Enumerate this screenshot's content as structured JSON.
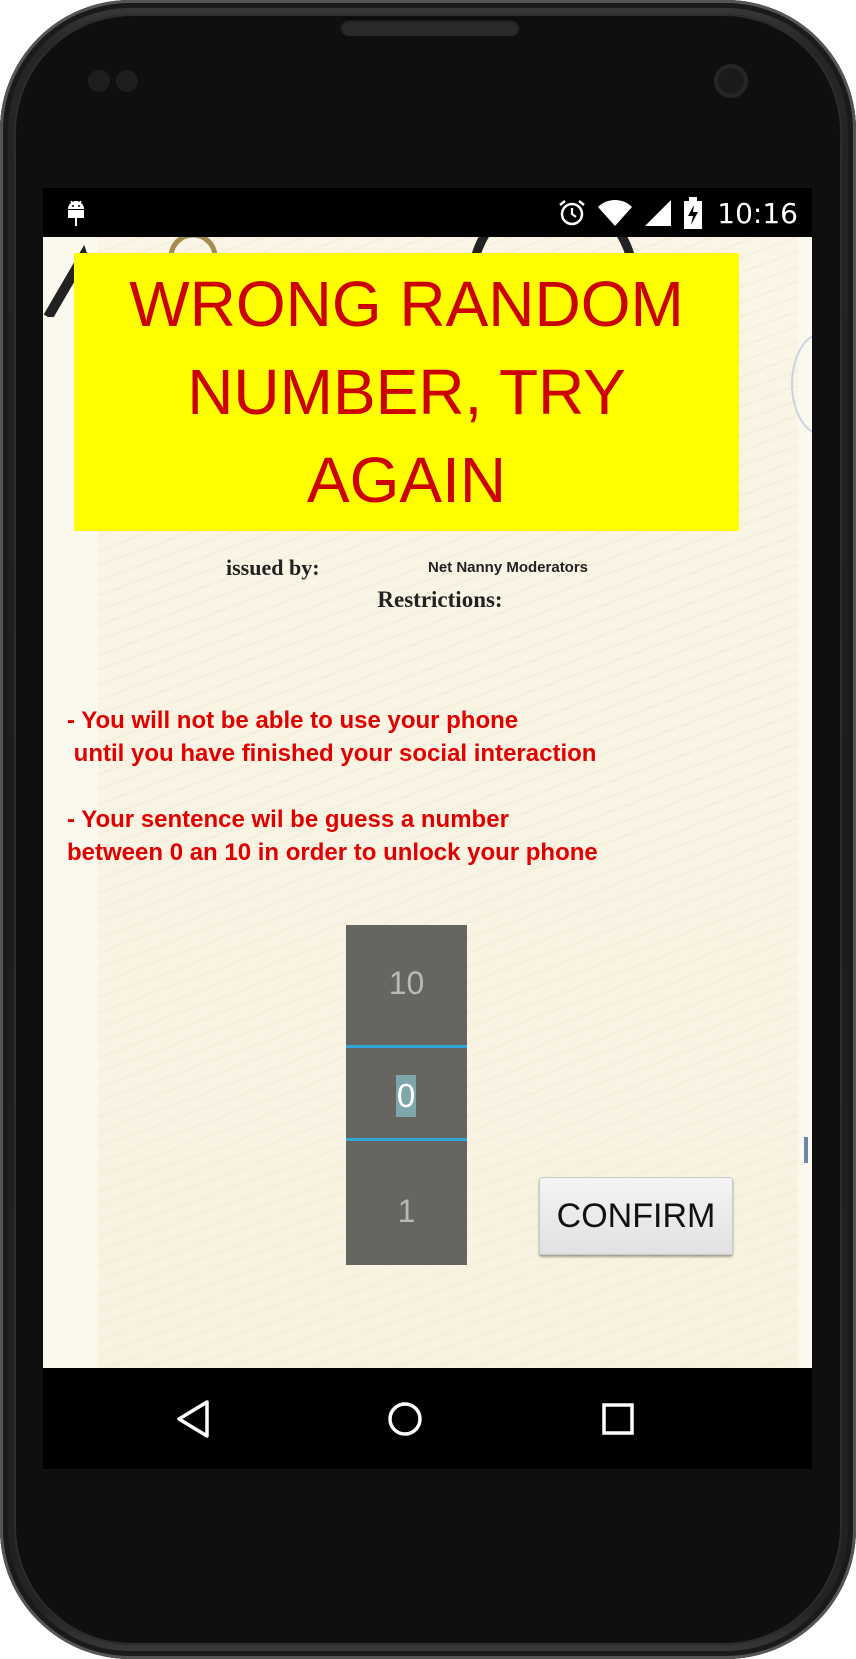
{
  "statusbar": {
    "time": "10:16",
    "icons": [
      "android-debug-icon",
      "alarm-icon",
      "wifi-icon",
      "signal-icon",
      "battery-charging-icon"
    ]
  },
  "banner": {
    "text": "WRONG RANDOM NUMBER, TRY AGAIN",
    "background_color": "#ffff00",
    "text_color": "#cc0000"
  },
  "certificate": {
    "issued_label": "issued by:",
    "issued_value": "Net Nanny Moderators",
    "restrictions_title": "Restrictions:",
    "rule_1": "- You will not be able to use your phone\n until you have finished your social interaction",
    "rule_2": "- Your sentence wil be guess a number\nbetween 0 an 10 in order to unlock your phone",
    "rule_color": "#e00000"
  },
  "number_picker": {
    "previous_value": "10",
    "current_value": "0",
    "next_value": "1",
    "accent_color": "#33a6d8"
  },
  "confirm_button": {
    "label": "CONFIRM"
  },
  "navbar": {
    "icons": [
      "back-icon",
      "home-icon",
      "recents-icon"
    ]
  }
}
